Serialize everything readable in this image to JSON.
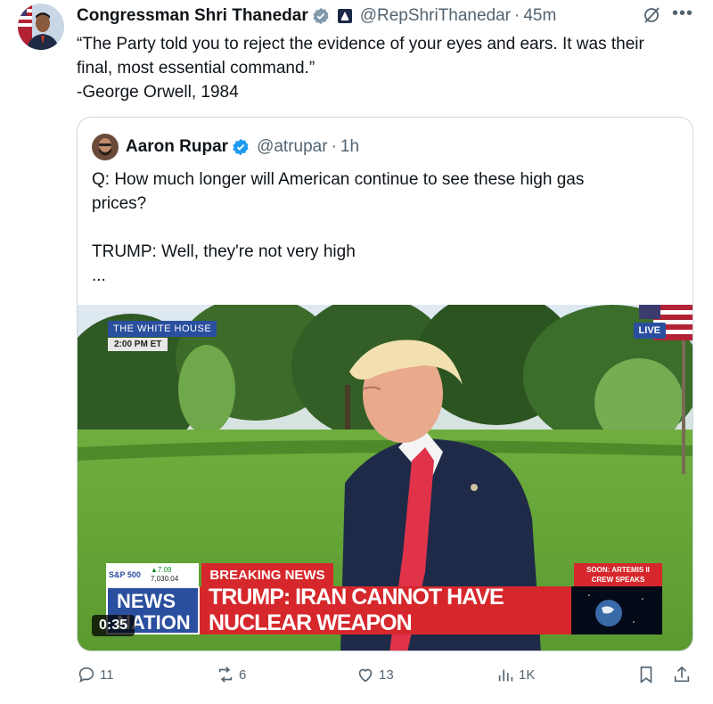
{
  "tweet": {
    "author_name": "Congressman Shri Thanedar",
    "handle": "@RepShriThanedar",
    "separator": "·",
    "time": "45m",
    "text_lines": [
      "“The Party told you to reject the evidence of your eyes and ears. It was their",
      "final, most essential command.”",
      "-George Orwell, 1984"
    ]
  },
  "quote": {
    "author_name": "Aaron Rupar",
    "handle": "@atrupar",
    "separator": "·",
    "time": "1h",
    "text_lines": [
      "Q: How much longer will American continue to see these high gas",
      "prices?",
      "",
      "TRUMP: Well, they're not very high",
      "..."
    ],
    "video": {
      "location_label": "THE WHITE HOUSE",
      "time_label": "2:00 PM ET",
      "live_label": "LIVE",
      "ticker_name": "S&P 500",
      "ticker_change": "▲7.09",
      "ticker_value": "7,030.04",
      "breaking_label": "BREAKING NEWS",
      "soon_label_1": "SOON: ARTEMIS II",
      "soon_label_2": "CREW SPEAKS",
      "news_line_1": "NEWS",
      "news_line_2": "NATION",
      "headline": "TRUMP: IRAN CANNOT HAVE NUCLEAR WEAPON",
      "duration": "0:35"
    }
  },
  "actions": {
    "replies": "11",
    "reposts": "6",
    "likes": "13",
    "views": "1K"
  },
  "colors": {
    "verified_blue": "#1d9bf0",
    "muted_text": "#536471",
    "news_red": "#d6282c",
    "news_blue": "#2a4f9e"
  },
  "icons": [
    "verified-badge-icon",
    "government-badge-icon",
    "grok-icon",
    "more-icon",
    "reply-icon",
    "repost-icon",
    "like-icon",
    "views-icon",
    "bookmark-icon",
    "share-icon"
  ]
}
